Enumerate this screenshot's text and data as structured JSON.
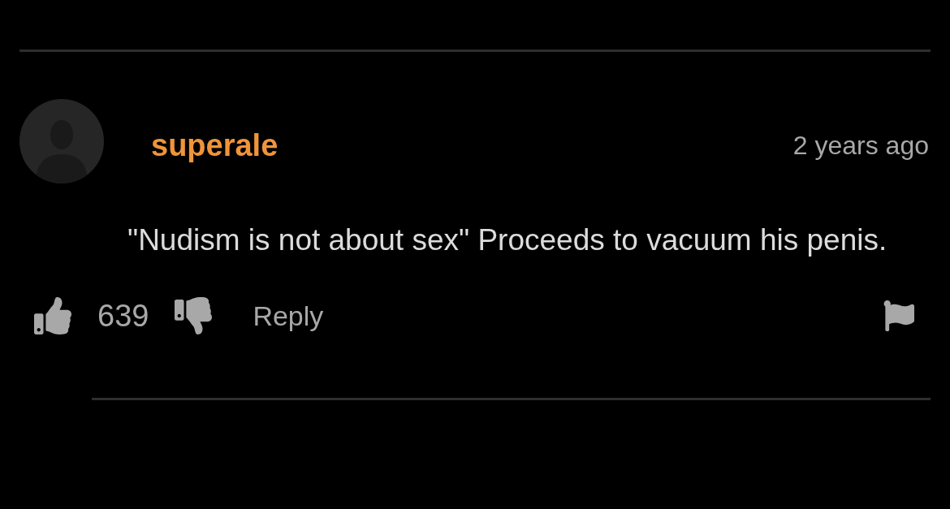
{
  "comment": {
    "author": "superale",
    "time": "2 years ago",
    "text": "\"Nudism is not about sex\" Proceeds to vacuum his penis.",
    "likes": "639",
    "reply_label": "Reply"
  }
}
